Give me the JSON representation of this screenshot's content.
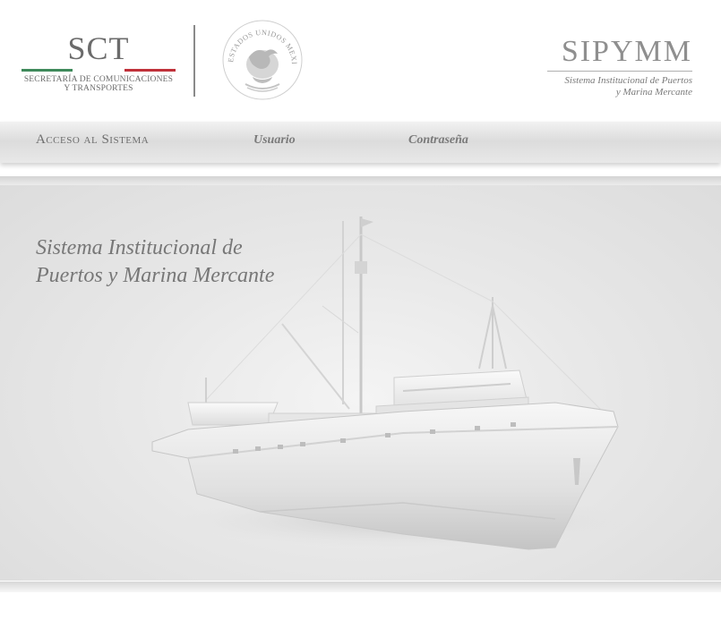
{
  "header": {
    "sct": {
      "abbr": "SCT",
      "name_line1": "SECRETARÍA DE COMUNICACIONES",
      "name_line2": "Y TRANSPORTES",
      "flag_colors": [
        "#3f8a5b",
        "#ffffff",
        "#c0313a"
      ]
    },
    "seal": {
      "text": "ESTADOS UNIDOS MEXICANOS",
      "icon": "national-seal-icon"
    },
    "sipymm": {
      "abbr": "SIPYMM",
      "name_line1": "Sistema Institucional de Puertos",
      "name_line2": "y Marina Mercante"
    }
  },
  "nav": {
    "title": "Acceso al Sistema",
    "user_link": "Usuario",
    "password_link": "Contraseña"
  },
  "hero": {
    "title_line1": "Sistema Institucional de",
    "title_line2": "Puertos y Marina Mercante",
    "image": "ship-icon"
  }
}
